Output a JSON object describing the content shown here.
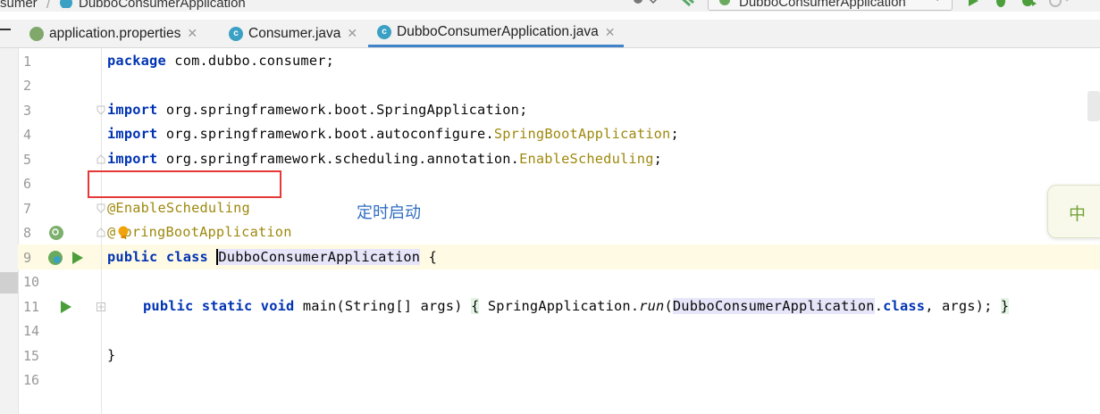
{
  "nav": {
    "breadcrumb_prev": "sumer",
    "breadcrumb_current": "DubboConsumerApplication",
    "run_config": "DubboConsumerApplication"
  },
  "tabs": [
    {
      "label": "application.properties",
      "icon": "spring-properties-icon",
      "active": false
    },
    {
      "label": "Consumer.java",
      "icon": "java-class-icon",
      "active": false
    },
    {
      "label": "DubboConsumerApplication.java",
      "icon": "spring-boot-class-icon",
      "active": true
    }
  ],
  "code": {
    "line_numbers": [
      "1",
      "2",
      "3",
      "4",
      "5",
      "6",
      "7",
      "8",
      "9",
      "10",
      "11",
      "14",
      "15",
      "16"
    ],
    "l1": [
      "package",
      " com.dubbo.consumer;"
    ],
    "l3": [
      "import",
      " org.springframework.boot.SpringApplication;"
    ],
    "l4": [
      "import",
      " org.springframework.boot.autoconfigure.",
      "SpringBootApplication",
      ";"
    ],
    "l5": [
      "import",
      " org.springframework.scheduling.annotation.",
      "EnableScheduling",
      ";"
    ],
    "l7": "@EnableScheduling",
    "l8": [
      "@",
      "pringBootApplication"
    ],
    "l9": [
      "public",
      " ",
      "class",
      " ",
      "DubboConsumerApplication",
      " {"
    ],
    "l11": [
      "public",
      " ",
      "static",
      " ",
      "void",
      " main(String[] args) ",
      "{",
      " SpringApplication.",
      "run",
      "(",
      "DubboConsumerApplication",
      ".",
      "class",
      ", args); ",
      "}"
    ],
    "l15": "}"
  },
  "annotation_note": "定时启动",
  "ime_indicator": "中",
  "colors": {
    "keyword": "#0033b3",
    "annotation": "#9e880d",
    "highlight_box": "#e53935",
    "note": "#2f6dc2",
    "active_tab": "#4083c9"
  }
}
